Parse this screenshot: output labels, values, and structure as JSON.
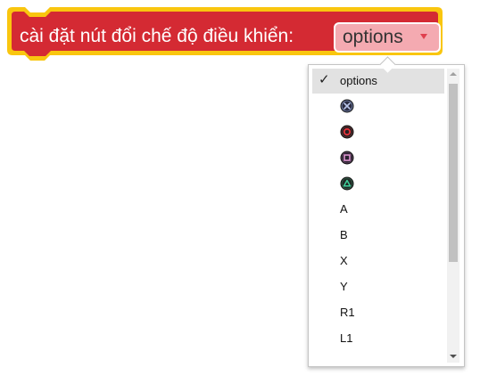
{
  "block": {
    "label": "cài đặt nút đổi chế độ điều khiển:",
    "fill_color": "#d42a33",
    "border_color": "#f9c60f"
  },
  "dropdown": {
    "value": "options",
    "field_color": "#f4aab1"
  },
  "menu": {
    "check_mark": "✓",
    "items": [
      {
        "label": "options",
        "selected": true
      },
      {
        "icon": "ps-cross-icon"
      },
      {
        "icon": "ps-circle-icon"
      },
      {
        "icon": "ps-square-icon"
      },
      {
        "icon": "ps-triangle-icon"
      },
      {
        "label": "A"
      },
      {
        "label": "B"
      },
      {
        "label": "X"
      },
      {
        "label": "Y"
      },
      {
        "label": "R1"
      },
      {
        "label": "L1"
      }
    ]
  }
}
